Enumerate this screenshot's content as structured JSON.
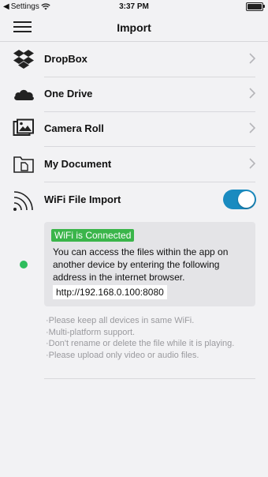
{
  "status_bar": {
    "back_label": "Settings",
    "time": "3:37 PM"
  },
  "nav": {
    "title": "Import"
  },
  "rows": [
    {
      "label": "DropBox",
      "icon": "dropbox-icon"
    },
    {
      "label": "One Drive",
      "icon": "onedrive-icon"
    },
    {
      "label": "Camera Roll",
      "icon": "photos-icon"
    },
    {
      "label": "My Document",
      "icon": "folder-icon"
    }
  ],
  "wifi": {
    "label": "WiFi File Import",
    "icon": "wifi-icon",
    "enabled": true,
    "status": "WiFi is Connected",
    "description": "You can access the files within the app on another device by entering the following address in the internet browser.",
    "address": "http://192.168.0.100:8080",
    "accent": "#1a8bc0",
    "connected_color": "#3ab54a"
  },
  "tips": [
    "·Please keep all devices in same WiFi.",
    "·Multi-platform support.",
    "·Don't rename or delete the file while it is playing.",
    "·Please upload only video or audio files."
  ]
}
